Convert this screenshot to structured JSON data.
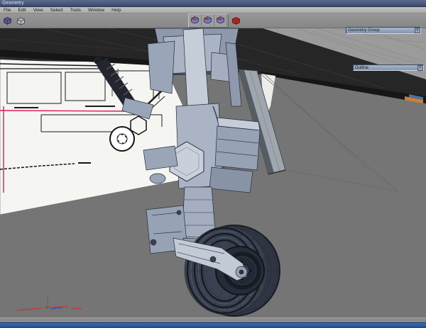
{
  "window": {
    "title": "Geometry"
  },
  "menu_bar": {
    "items": [
      "File",
      "Edit",
      "View",
      "Select",
      "Tools",
      "Window",
      "Help"
    ]
  },
  "toolbar": {
    "left_icons": [
      "solid-cube-icon",
      "wire-cube-icon"
    ],
    "center_icons": [
      "shaded-model-icon-1",
      "shaded-model-icon-2",
      "shaded-model-icon-3"
    ],
    "red_icon": "red-model-icon"
  },
  "viewport_overlays": {
    "group_combo": {
      "value": "Geometry Group",
      "close_glyph": "×"
    },
    "outline_combo": {
      "value": "Outline",
      "close_glyph": "×"
    }
  },
  "colors": {
    "titlebar_blue": "#46567c",
    "menubar_gray": "#b5b5b5",
    "toolbar_gray": "#8d8d8d",
    "viewport_gray": "#757575",
    "paper_white": "#f5f5f2",
    "belly_dark": "#262626",
    "model_steel_light": "#c5cdd9",
    "model_steel": "#aab4c4",
    "model_steel_dark": "#97a2b5",
    "outline_ink": "#272d3a",
    "guide_magenta": "#e0185c",
    "axis_red": "#c23b3b",
    "axis_green": "#2e7d4f",
    "axis_blue": "#3b55c2",
    "taskbar_blue": "#2456a0",
    "icon_purple": "#7a7ab8",
    "icon_red": "#b22828"
  }
}
